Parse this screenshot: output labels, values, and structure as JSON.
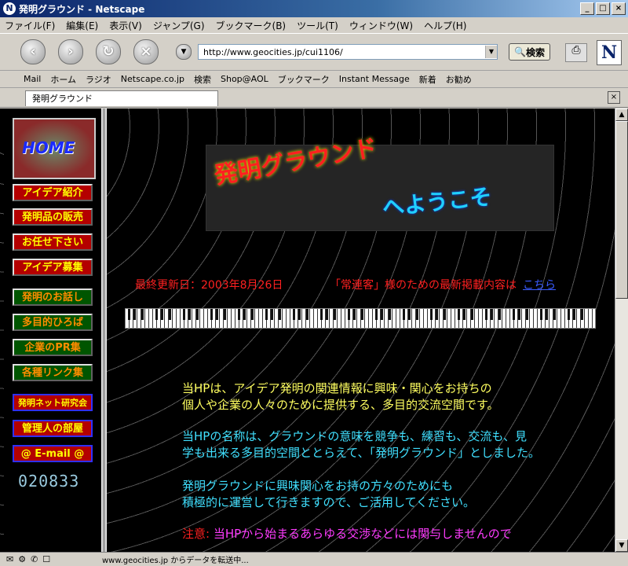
{
  "window": {
    "title": "発明グラウンド - Netscape",
    "app_icon": "N"
  },
  "menus": [
    "ファイル(F)",
    "編集(E)",
    "表示(V)",
    "ジャンプ(G)",
    "ブックマーク(B)",
    "ツール(T)",
    "ウィンドウ(W)",
    "ヘルプ(H)"
  ],
  "nav": {
    "url": "http://www.geocities.jp/cui1106/",
    "search_label": "検索"
  },
  "bookmarks": [
    "Mail",
    "ホーム",
    "ラジオ",
    "Netscape.co.jp",
    "検索",
    "Shop@AOL",
    "ブックマーク",
    "Instant Message",
    "新着",
    "お勧め"
  ],
  "tab": {
    "label": "発明グラウンド"
  },
  "sidebar": {
    "home_label": "HOME",
    "items": [
      {
        "label": "アイデア紹介"
      },
      {
        "label": "発明品の販売"
      },
      {
        "label": "お任せ下さい"
      },
      {
        "label": "アイデア募集"
      },
      {
        "label": "発明のお話し"
      },
      {
        "label": "多目的ひろば"
      },
      {
        "label": "企業のPR集"
      },
      {
        "label": "各種リンク集"
      },
      {
        "label": "発明ネット研究会"
      },
      {
        "label": "管理人の部屋"
      },
      {
        "label": "@ E-mail @"
      }
    ],
    "counter": "020833"
  },
  "banner": {
    "line1": "発明グラウンド",
    "line2": "へようこそ"
  },
  "updated": "最終更新日：2003年8月26日",
  "regular": {
    "text": "「常連客」様のための最新掲載内容は",
    "link": "こちら"
  },
  "paragraphs": {
    "p1a": "当HPは、アイデア発明の関連情報に興味・関心をお持ちの",
    "p1b": "個人や企業の人々のために提供する、多目的交流空間です。",
    "p2a": "当HPの名称は、グラウンドの意味を競争も、練習も、交流も、見",
    "p2b": "学も出来る多目的空間ととらえて、「発明グラウンド」としました。",
    "p3a": "発明グラウンドに興味関心をお持の方々のためにも",
    "p3b": "積極的に運営して行きますので、ご活用してください。",
    "p4_label": "注意:",
    "p4a": "当HPから始まるあらゆる交渉などには関与しませんので"
  },
  "status": {
    "text": "www.geocities.jp からデータを転送中..."
  }
}
